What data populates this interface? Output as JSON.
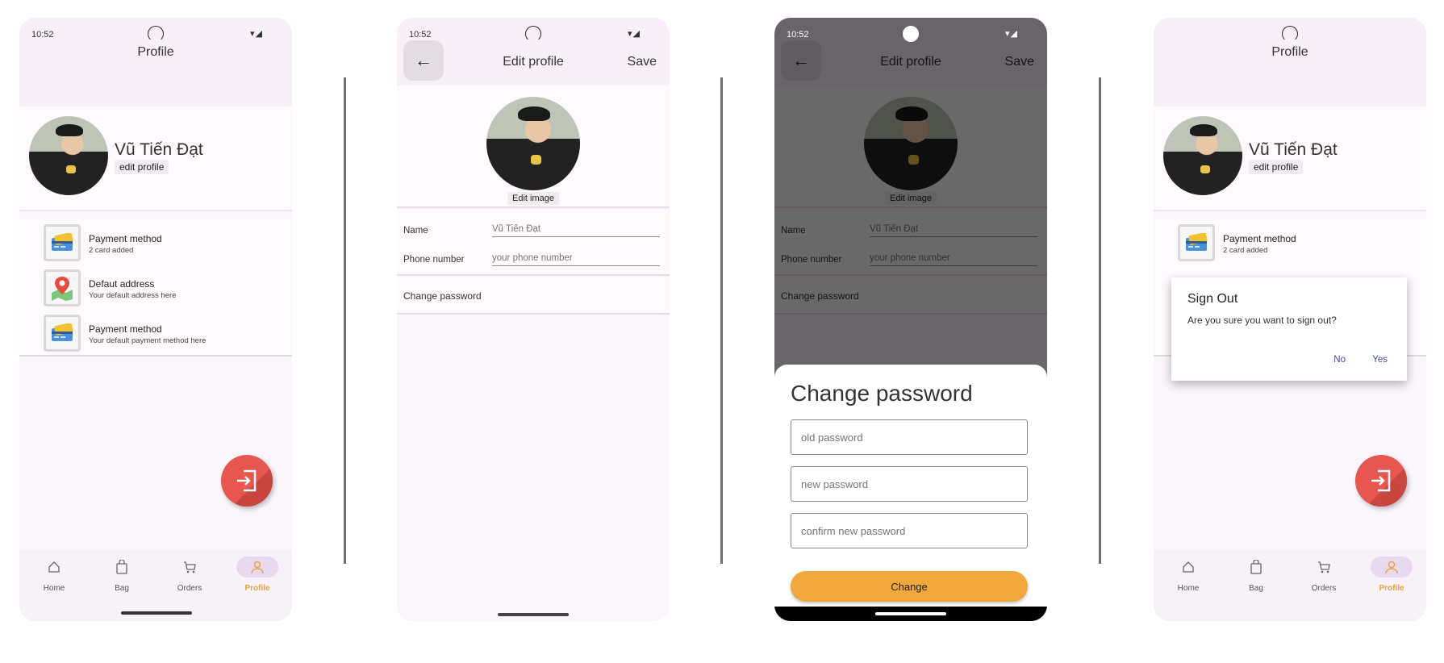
{
  "status_time": "10:52",
  "status_icons": "▾◢",
  "profile": {
    "title": "Profile",
    "user_name": "Vũ Tiến Đạt",
    "edit_profile_label": "edit profile",
    "menu": [
      {
        "title": "Payment method",
        "subtitle": "2 card added",
        "icon": "credit-card-icon"
      },
      {
        "title": "Defaut address",
        "subtitle": "Your default address here",
        "icon": "map-pin-icon"
      },
      {
        "title": "Payment method",
        "subtitle": "Your default payment method here",
        "icon": "credit-card-icon"
      }
    ]
  },
  "nav": [
    {
      "label": "Home",
      "icon": "home-icon"
    },
    {
      "label": "Bag",
      "icon": "bag-icon"
    },
    {
      "label": "Orders",
      "icon": "orders-icon"
    },
    {
      "label": "Profile",
      "icon": "person-icon",
      "active": true
    }
  ],
  "edit_profile": {
    "title": "Edit profile",
    "save_label": "Save",
    "back_icon": "←",
    "edit_image_label": "Edit image",
    "name_label": "Name",
    "name_value": "Vũ Tiến Đạt",
    "phone_label": "Phone number",
    "phone_placeholder": "your phone number",
    "change_password_label": "Change password"
  },
  "change_password_sheet": {
    "title": "Change password",
    "old_placeholder": "old password",
    "new_placeholder": "new password",
    "confirm_placeholder": "confirm new password",
    "button_label": "Change"
  },
  "sign_out_dialog": {
    "title": "Sign Out",
    "message": "Are you sure you want to sign out?",
    "no_label": "No",
    "yes_label": "Yes"
  },
  "colors": {
    "accent": "#f0a83c",
    "fab": "#e7574f",
    "background": "#fbf6fc",
    "dialog_button": "#4a4aa0"
  }
}
